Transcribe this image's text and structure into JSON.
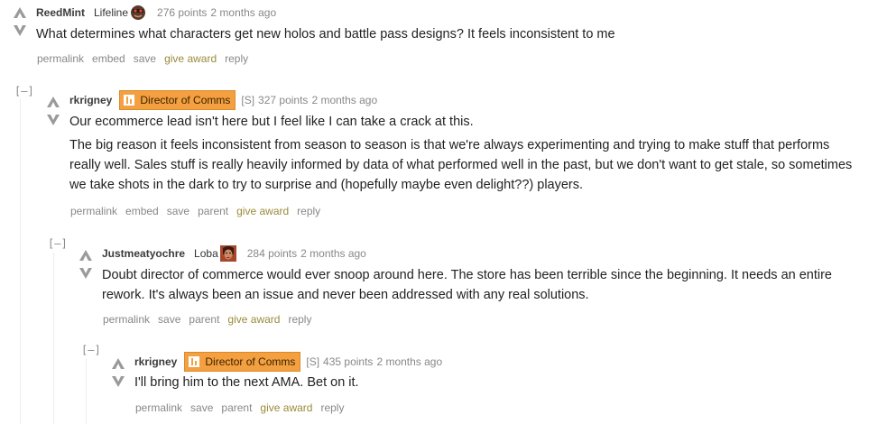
{
  "comments": [
    {
      "collapse": "",
      "author": "ReedMint",
      "flair": "Lifeline",
      "flair_icon": "lifeline-avatar-icon",
      "points": "276 points",
      "time": "2 months ago",
      "paragraphs": [
        "What determines what characters get new holos and battle pass designs? It feels inconsistent to me"
      ],
      "actions": [
        "permalink",
        "embed",
        "save",
        "give award",
        "reply"
      ]
    },
    {
      "collapse": "[–]",
      "author": "rkrigney",
      "badge": "Director of Comms",
      "s_tag": "[S]",
      "points": "327 points",
      "time": "2 months ago",
      "paragraphs": [
        "Our ecommerce lead isn't here but I feel like I can take a crack at this.",
        "The big reason it feels inconsistent from season to season is that we're always experimenting and trying to make stuff that performs really well. Sales stuff is really heavily informed by data of what performed well in the past, but we don't want to get stale, so sometimes we take shots in the dark to try to surprise and (hopefully maybe even delight??) players."
      ],
      "actions": [
        "permalink",
        "embed",
        "save",
        "parent",
        "give award",
        "reply"
      ]
    },
    {
      "collapse": "[–]",
      "author": "Justmeatyochre",
      "flair": "Loba",
      "flair_icon": "loba-avatar-icon",
      "points": "284 points",
      "time": "2 months ago",
      "paragraphs": [
        "Doubt director of commerce would ever snoop around here. The store has been terrible since the beginning. It needs an entire rework. It's always been an issue and never been addressed with any real solutions."
      ],
      "actions": [
        "permalink",
        "save",
        "parent",
        "give award",
        "reply"
      ]
    },
    {
      "collapse": "[–]",
      "author": "rkrigney",
      "badge": "Director of Comms",
      "s_tag": "[S]",
      "points": "435 points",
      "time": "2 months ago",
      "paragraphs": [
        "I'll bring him to the next AMA. Bet on it."
      ],
      "actions": [
        "permalink",
        "save",
        "parent",
        "give award",
        "reply"
      ]
    }
  ],
  "colors": {
    "badge": "#f4a040",
    "award": "#9a8a3a",
    "meta": "#888888"
  }
}
